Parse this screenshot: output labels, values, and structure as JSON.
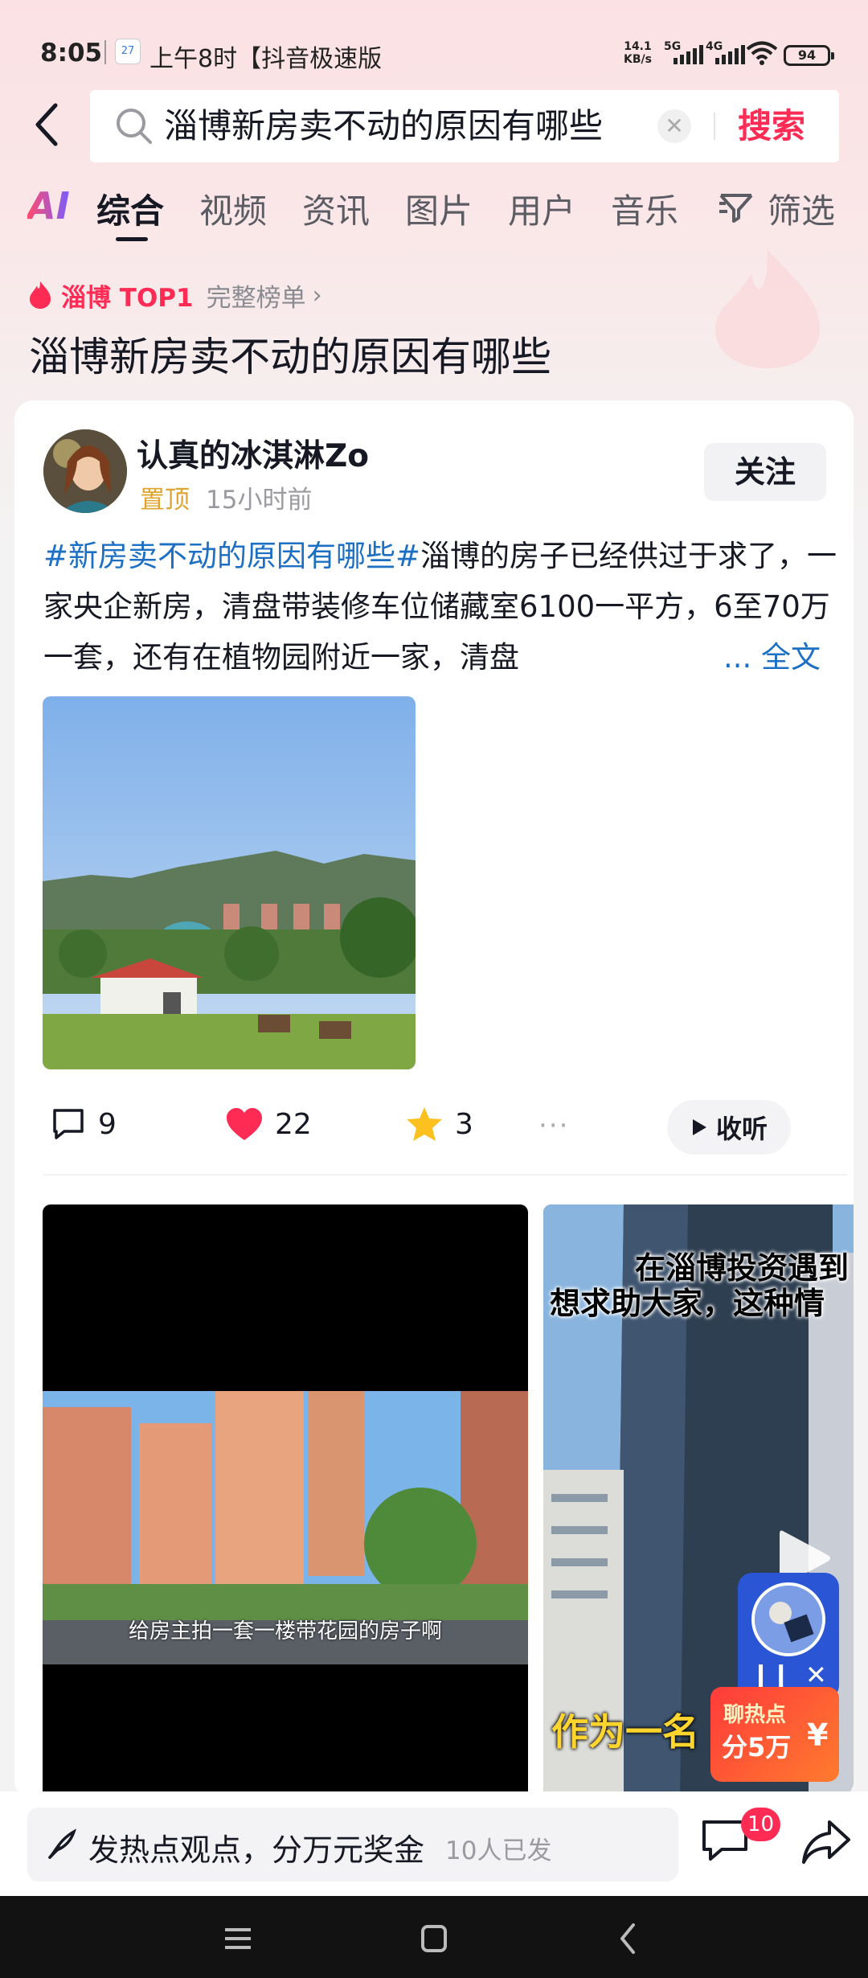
{
  "status_bar": {
    "time": "8:05",
    "app_icon_text": "27",
    "notification": "上午8时【抖音极速版",
    "net_speed_value": "14.1",
    "net_speed_unit": "KB/s",
    "signal1": "5G",
    "signal2": "4G",
    "battery": "94"
  },
  "search": {
    "query": "淄博新房卖不动的原因有哪些",
    "submit_label": "搜索"
  },
  "tabs": {
    "ai_label": "AI",
    "items": [
      "综合",
      "视频",
      "资讯",
      "图片",
      "用户",
      "音乐"
    ],
    "active_index": 0,
    "filter_label": "筛选"
  },
  "hot_topic": {
    "rank": "淄博 TOP1",
    "full_list": "完整榜单",
    "title": "淄博新房卖不动的原因有哪些"
  },
  "post": {
    "author": "认真的冰淇淋Zo",
    "pinned": "置顶",
    "time": "15小时前",
    "follow_label": "关注",
    "hashtag": "#新房卖不动的原因有哪些#",
    "text": "淄博的房子已经供过于求了，一家央企新房，清盘带装修车位储藏室6100一平方，6至70万一套，还有在植物园附近一家，清盘",
    "more_label": "... 全文",
    "comments": "9",
    "likes": "22",
    "favorites": "3",
    "listen_label": "收听"
  },
  "videos": {
    "v1_caption": "给房主拍一套一楼带花园的房子啊",
    "v2_title_line1": "在淄博投资遇到",
    "v2_title_line2": "想求助大家，这种情",
    "v2_bottom_text": "作为一名"
  },
  "floating": {
    "reward_line1": "聊热点",
    "reward_line2": "分5万",
    "reward_symbol": "¥"
  },
  "bottom_bar": {
    "placeholder": "发热点观点，分万元奖金",
    "participants": "10人已发",
    "comment_badge": "10"
  },
  "colors": {
    "accent_red": "#fe2c55",
    "link_blue": "#1d6fc4",
    "pin_gold": "#e0a431"
  }
}
